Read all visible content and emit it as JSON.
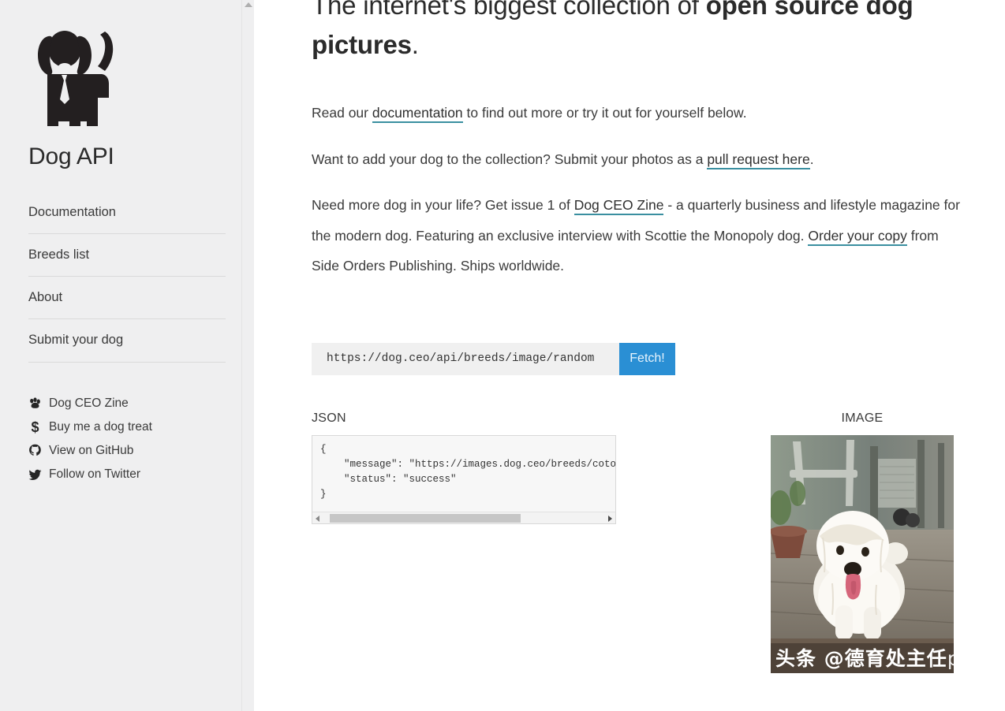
{
  "sidebar": {
    "logo_icon": "dog-with-tie-logo",
    "title": "Dog API",
    "nav": [
      {
        "label": "Documentation",
        "name": "documentation"
      },
      {
        "label": "Breeds list",
        "name": "breeds-list"
      },
      {
        "label": "About",
        "name": "about"
      },
      {
        "label": "Submit your dog",
        "name": "submit-your-dog"
      }
    ],
    "social": [
      {
        "label": "Dog CEO Zine",
        "icon": "paw-icon",
        "name": "dog-ceo-zine"
      },
      {
        "label": "Buy me a dog treat",
        "icon": "dollar-icon",
        "name": "buy-me-a-dog-treat"
      },
      {
        "label": "View on GitHub",
        "icon": "github-icon",
        "name": "view-on-github"
      },
      {
        "label": "Follow on Twitter",
        "icon": "twitter-icon",
        "name": "follow-on-twitter"
      }
    ]
  },
  "main": {
    "hero": {
      "lead": "The internet's biggest collection of ",
      "emphasis": "open source dog pictures",
      "trail": "."
    },
    "paragraphs": {
      "p1_a": "Read our ",
      "p1_link": "documentation",
      "p1_b": " to find out more or try it out for yourself below.",
      "p2_a": "Want to add your dog to the collection? Submit your photos as a ",
      "p2_link": "pull request here",
      "p2_b": ".",
      "p3_a": "Need more dog in your life? Get issue 1 of ",
      "p3_link1": "Dog CEO Zine",
      "p3_b": " - a quarterly business and lifestyle magazine for the modern dog. Featuring an exclusive interview with Scottie the Monopoly dog. ",
      "p3_link2": "Order your copy",
      "p3_c": " from Side Orders Publishing. Ships worldwide."
    },
    "form": {
      "url_value": "https://dog.ceo/api/breeds/image/random",
      "url_placeholder": "https://dog.ceo/api/breeds/image/random",
      "fetch_label": "Fetch!"
    },
    "results": {
      "json_label": "JSON",
      "image_label": "IMAGE",
      "json_body": "{\n    \"message\": \"https://images.dog.ceo/breeds/cotond\n    \"status\": \"success\"\n}",
      "image_alt": "white-fluffy-dog-on-deck",
      "watermark_main": "头条 @德育处主任",
      "watermark_suffix": "pro"
    }
  },
  "colors": {
    "sidebar_bg": "#efeff0",
    "accent_button": "#2a8fd4",
    "link_underline": "#3a8fa0",
    "text": "#3a3a3a"
  }
}
